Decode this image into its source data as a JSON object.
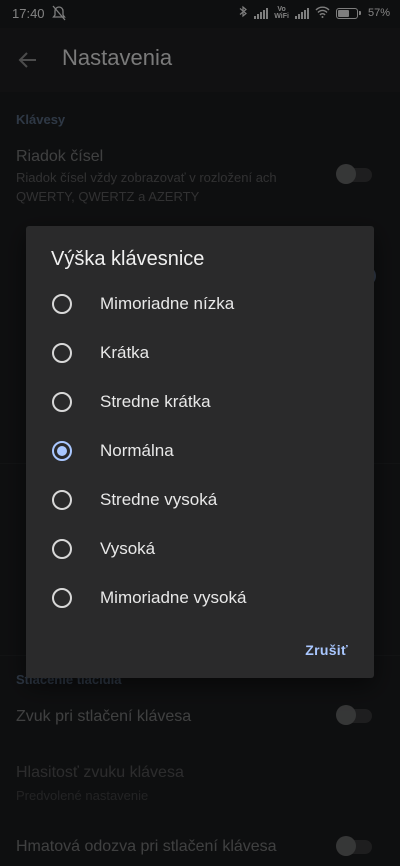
{
  "status_bar": {
    "time": "17:40",
    "vo_label": "Vo",
    "wifi_label": "WiFi",
    "battery": "57%"
  },
  "app_bar": {
    "title": "Nastavenia"
  },
  "settings": {
    "keys_section": "Klávesy",
    "number_row_title": "Riadok čísel",
    "number_row_subtitle": "Riadok čísel vždy zobrazovať v rozložení ach QWERTY, QWERTZ a AZERTY",
    "press_section": "Stlačenie tlačidla",
    "sound_title": "Zvuk pri stlačení klávesa",
    "volume_title": "Hlasitosť zvuku klávesa",
    "volume_subtitle": "Predvolené nastavenie",
    "haptic_title": "Hmatová odozva pri stlačení klávesa"
  },
  "dialog": {
    "title": "Výška klávesnice",
    "options": [
      {
        "label": "Mimoriadne nízka",
        "selected": false
      },
      {
        "label": "Krátka",
        "selected": false
      },
      {
        "label": "Stredne krátka",
        "selected": false
      },
      {
        "label": "Normálna",
        "selected": true
      },
      {
        "label": "Stredne vysoká",
        "selected": false
      },
      {
        "label": "Vysoká",
        "selected": false
      },
      {
        "label": "Mimoriadne vysoká",
        "selected": false
      }
    ],
    "cancel_label": "Zrušiť"
  },
  "colors": {
    "accent": "#a9c7ff",
    "dialog_bg": "#2a2a2b",
    "screen_bg": "#1b1c1e"
  }
}
